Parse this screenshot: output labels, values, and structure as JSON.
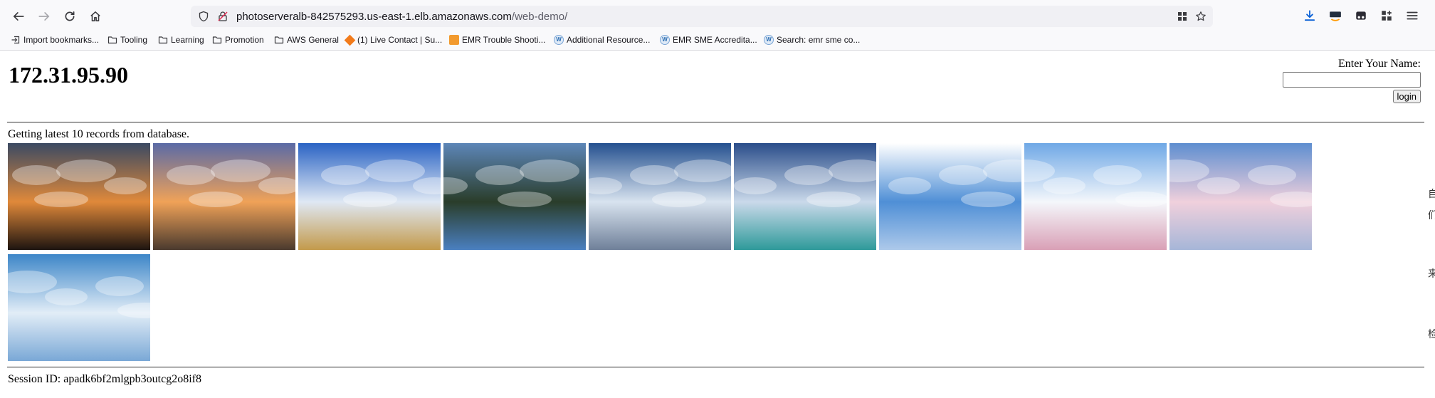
{
  "browser": {
    "url_host": "photoserveralb-842575293.us-east-1.elb.amazonaws.com",
    "url_path": "/web-demo/",
    "bookmarks": [
      {
        "label": "Import bookmarks...",
        "icon": "import-icon"
      },
      {
        "label": "Tooling",
        "icon": "folder-icon"
      },
      {
        "label": "Learning",
        "icon": "folder-icon"
      },
      {
        "label": "Promotion",
        "icon": "folder-icon"
      },
      {
        "label": "AWS General",
        "icon": "folder-icon"
      },
      {
        "label": "(1) Live Contact | Su...",
        "icon": "box-icon"
      },
      {
        "label": "EMR Trouble Shooti...",
        "icon": "emr-icon"
      },
      {
        "label": "Additional Resource...",
        "icon": "w-icon"
      },
      {
        "label": "EMR SME Accredita...",
        "icon": "w-icon"
      },
      {
        "label": "Search: emr sme co...",
        "icon": "w-icon"
      }
    ],
    "w_glyph": "W"
  },
  "page": {
    "ip_address": "172.31.95.90",
    "login_label": "Enter Your Name:",
    "name_value": "",
    "login_button": "login",
    "records_text": "Getting latest 10 records from database.",
    "session_text": "Session ID: apadk6bf2mlgpb3outcg2o8if8"
  },
  "photos": [
    {
      "name": "sunset-clouds-photo",
      "colors": [
        "#3b4a63",
        "#e0893a",
        "#1d1410"
      ]
    },
    {
      "name": "beach-sunset-photo",
      "colors": [
        "#5a6aa6",
        "#f0a258",
        "#4a3a2e"
      ]
    },
    {
      "name": "road-sky-photo",
      "colors": [
        "#2a63c4",
        "#dfe8f4",
        "#c39a4b"
      ]
    },
    {
      "name": "lake-reflection-photo",
      "colors": [
        "#5d86b8",
        "#2a3d2a",
        "#4a7fc0"
      ]
    },
    {
      "name": "pier-clouds-photo",
      "colors": [
        "#24508f",
        "#d8e3ef",
        "#6f8099"
      ]
    },
    {
      "name": "ocean-clouds-photo",
      "colors": [
        "#2a4d8a",
        "#cad9ea",
        "#2e9a9a"
      ]
    },
    {
      "name": "sun-rays-photo",
      "colors": [
        "#ffffff",
        "#4f8fd6",
        "#adc9ea"
      ]
    },
    {
      "name": "rainbow-clouds-photo",
      "colors": [
        "#6fa8e6",
        "#f4f7fb",
        "#d9a0b6"
      ]
    },
    {
      "name": "pink-clouds-photo",
      "colors": [
        "#5e8ed0",
        "#f0d0dc",
        "#a6b6d8"
      ]
    },
    {
      "name": "blue-clouds-photo",
      "colors": [
        "#3d86c8",
        "#e2edf7",
        "#7aa8d6"
      ]
    }
  ],
  "side_chars": [
    "自",
    "们",
    "来",
    "检"
  ]
}
